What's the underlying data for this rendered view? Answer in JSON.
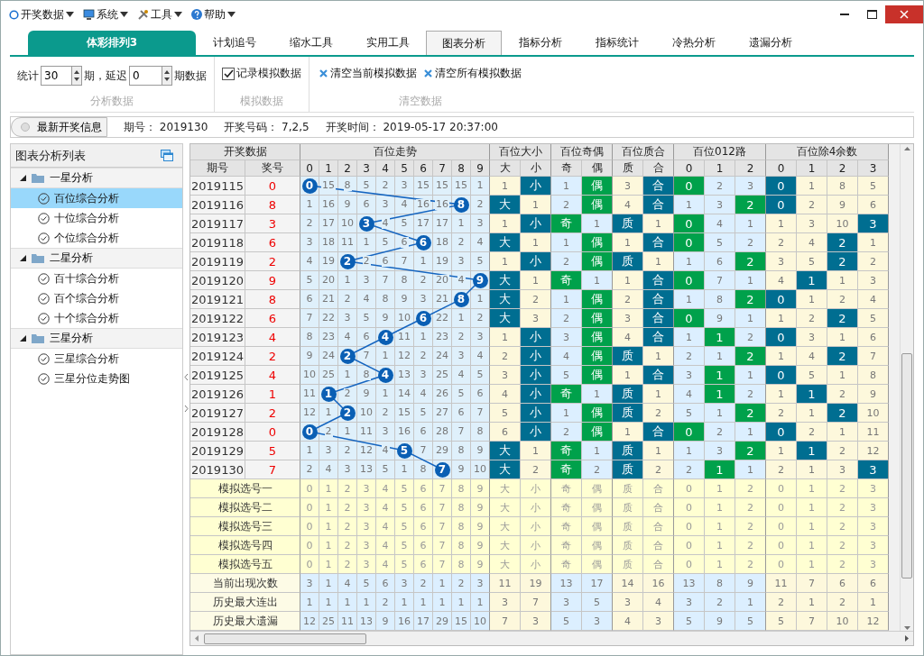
{
  "menu": [
    {
      "label": "开奖数据"
    },
    {
      "label": "系统"
    },
    {
      "label": "工具"
    },
    {
      "label": "帮助"
    }
  ],
  "tabs": [
    {
      "label": "体彩排列3",
      "kind": "product",
      "selected": false
    },
    {
      "label": "计划追号",
      "kind": "tab",
      "selected": false
    },
    {
      "label": "缩水工具",
      "kind": "tab",
      "selected": false
    },
    {
      "label": "实用工具",
      "kind": "tab",
      "selected": false
    },
    {
      "label": "图表分析",
      "kind": "tab",
      "selected": true
    },
    {
      "label": "指标分析",
      "kind": "tab",
      "selected": false
    },
    {
      "label": "指标统计",
      "kind": "tab",
      "selected": false
    },
    {
      "label": "冷热分析",
      "kind": "tab",
      "selected": false
    },
    {
      "label": "遗漏分析",
      "kind": "tab",
      "selected": false
    }
  ],
  "analysis": {
    "caption": "分析数据",
    "prefix": "统计",
    "periods": "30",
    "middle": "期，延迟",
    "delay": "0",
    "suffix": "期数据"
  },
  "simulation": {
    "caption": "模拟数据",
    "checkbox": {
      "label": "记录模拟数据",
      "checked": true
    }
  },
  "clear": {
    "caption": "清空数据",
    "buttons": [
      "清空当前模拟数据",
      "清空所有模拟数据"
    ]
  },
  "info": {
    "toggle": "最新开奖信息",
    "fields": [
      {
        "label": "期号：",
        "value": "2019130"
      },
      {
        "label": "开奖号码：",
        "value": "7,2,5"
      },
      {
        "label": "开奖时间：",
        "value": "2019-05-17 20:37:00"
      }
    ]
  },
  "sidebar": {
    "title": "图表分析列表",
    "groups": [
      {
        "label": "一星分析",
        "expanded": true,
        "children": [
          {
            "label": "百位综合分析",
            "selected": true
          },
          {
            "label": "十位综合分析",
            "selected": false
          },
          {
            "label": "个位综合分析",
            "selected": false
          }
        ]
      },
      {
        "label": "二星分析",
        "expanded": true,
        "children": [
          {
            "label": "百十综合分析",
            "selected": false
          },
          {
            "label": "百个综合分析",
            "selected": false
          },
          {
            "label": "十个综合分析",
            "selected": false
          }
        ]
      },
      {
        "label": "三星分析",
        "expanded": true,
        "children": [
          {
            "label": "三星综合分析",
            "selected": false
          },
          {
            "label": "三星分位走势图",
            "selected": false
          }
        ]
      }
    ]
  },
  "table": {
    "draw_title": "开奖数据",
    "period_header": "期号",
    "number_header": "奖号",
    "trend_title": "百位走势",
    "digits": [
      "0",
      "1",
      "2",
      "3",
      "4",
      "5",
      "6",
      "7",
      "8",
      "9"
    ],
    "groups": [
      {
        "title": "百位大小",
        "color": "#006e91",
        "columns": [
          "大",
          "小"
        ]
      },
      {
        "title": "百位奇偶",
        "color": "#00a14b",
        "columns": [
          "奇",
          "偶"
        ]
      },
      {
        "title": "百位质合",
        "color": "#006e91",
        "columns": [
          "质",
          "合"
        ]
      },
      {
        "title": "百位012路",
        "color": "#00a14b",
        "columns": [
          "0",
          "1",
          "2"
        ]
      },
      {
        "title": "百位除4余数",
        "color": "#006e91",
        "columns": [
          "0",
          "1",
          "2",
          "3"
        ]
      }
    ],
    "rows": [
      {
        "period": "2019115",
        "number": "0",
        "cells": [
          "0",
          "15",
          "8",
          "5",
          "2",
          "3",
          "15",
          "15",
          "15",
          "1",
          "1",
          "小",
          "1",
          "偶",
          "3",
          "合",
          "0",
          "2",
          "3",
          "0",
          "1",
          "8",
          "5"
        ],
        "hits": [
          true,
          false,
          false,
          false,
          false,
          false,
          false,
          false,
          false,
          false,
          false,
          true,
          false,
          true,
          false,
          true,
          true,
          false,
          false,
          true,
          false,
          false,
          false
        ]
      },
      {
        "period": "2019116",
        "number": "8",
        "cells": [
          "1",
          "16",
          "9",
          "6",
          "3",
          "4",
          "16",
          "16",
          "8",
          "2",
          "大",
          "1",
          "2",
          "偶",
          "4",
          "合",
          "1",
          "3",
          "2",
          "0",
          "2",
          "9",
          "6"
        ],
        "hits": [
          false,
          false,
          false,
          false,
          false,
          false,
          false,
          false,
          true,
          false,
          true,
          false,
          false,
          true,
          false,
          true,
          false,
          false,
          true,
          true,
          false,
          false,
          false
        ]
      },
      {
        "period": "2019117",
        "number": "3",
        "cells": [
          "2",
          "17",
          "10",
          "3",
          "4",
          "5",
          "17",
          "17",
          "1",
          "3",
          "1",
          "小",
          "奇",
          "1",
          "质",
          "1",
          "0",
          "4",
          "1",
          "1",
          "3",
          "10",
          "3"
        ],
        "hits": [
          false,
          false,
          false,
          true,
          false,
          false,
          false,
          false,
          false,
          false,
          false,
          true,
          true,
          false,
          true,
          false,
          true,
          false,
          false,
          false,
          false,
          false,
          true
        ]
      },
      {
        "period": "2019118",
        "number": "6",
        "cells": [
          "3",
          "18",
          "11",
          "1",
          "5",
          "6",
          "6",
          "18",
          "2",
          "4",
          "大",
          "1",
          "1",
          "偶",
          "1",
          "合",
          "0",
          "5",
          "2",
          "2",
          "4",
          "2",
          "1"
        ],
        "hits": [
          false,
          false,
          false,
          false,
          false,
          false,
          true,
          false,
          false,
          false,
          true,
          false,
          false,
          true,
          false,
          true,
          true,
          false,
          false,
          false,
          false,
          true,
          false
        ]
      },
      {
        "period": "2019119",
        "number": "2",
        "cells": [
          "4",
          "19",
          "2",
          "2",
          "6",
          "7",
          "1",
          "19",
          "3",
          "5",
          "1",
          "小",
          "2",
          "偶",
          "质",
          "1",
          "1",
          "6",
          "2",
          "3",
          "5",
          "2",
          "2"
        ],
        "hits": [
          false,
          false,
          true,
          false,
          false,
          false,
          false,
          false,
          false,
          false,
          false,
          true,
          false,
          true,
          true,
          false,
          false,
          false,
          true,
          false,
          false,
          true,
          false
        ]
      },
      {
        "period": "2019120",
        "number": "9",
        "cells": [
          "5",
          "20",
          "1",
          "3",
          "7",
          "8",
          "2",
          "20",
          "4",
          "9",
          "大",
          "1",
          "奇",
          "1",
          "1",
          "合",
          "0",
          "7",
          "1",
          "4",
          "1",
          "1",
          "3"
        ],
        "hits": [
          false,
          false,
          false,
          false,
          false,
          false,
          false,
          false,
          false,
          true,
          true,
          false,
          true,
          false,
          false,
          true,
          true,
          false,
          false,
          false,
          true,
          false,
          false
        ]
      },
      {
        "period": "2019121",
        "number": "8",
        "cells": [
          "6",
          "21",
          "2",
          "4",
          "8",
          "9",
          "3",
          "21",
          "8",
          "1",
          "大",
          "2",
          "1",
          "偶",
          "2",
          "合",
          "1",
          "8",
          "2",
          "0",
          "1",
          "2",
          "4"
        ],
        "hits": [
          false,
          false,
          false,
          false,
          false,
          false,
          false,
          false,
          true,
          false,
          true,
          false,
          false,
          true,
          false,
          true,
          false,
          false,
          true,
          true,
          false,
          false,
          false
        ]
      },
      {
        "period": "2019122",
        "number": "6",
        "cells": [
          "7",
          "22",
          "3",
          "5",
          "9",
          "10",
          "6",
          "22",
          "1",
          "2",
          "大",
          "3",
          "2",
          "偶",
          "3",
          "合",
          "0",
          "9",
          "1",
          "1",
          "2",
          "2",
          "5"
        ],
        "hits": [
          false,
          false,
          false,
          false,
          false,
          false,
          true,
          false,
          false,
          false,
          true,
          false,
          false,
          true,
          false,
          true,
          true,
          false,
          false,
          false,
          false,
          true,
          false
        ]
      },
      {
        "period": "2019123",
        "number": "4",
        "cells": [
          "8",
          "23",
          "4",
          "6",
          "4",
          "11",
          "1",
          "23",
          "2",
          "3",
          "1",
          "小",
          "3",
          "偶",
          "4",
          "合",
          "1",
          "1",
          "2",
          "0",
          "3",
          "1",
          "6"
        ],
        "hits": [
          false,
          false,
          false,
          false,
          true,
          false,
          false,
          false,
          false,
          false,
          false,
          true,
          false,
          true,
          false,
          true,
          false,
          true,
          false,
          true,
          false,
          false,
          false
        ]
      },
      {
        "period": "2019124",
        "number": "2",
        "cells": [
          "9",
          "24",
          "2",
          "7",
          "1",
          "12",
          "2",
          "24",
          "3",
          "4",
          "2",
          "小",
          "4",
          "偶",
          "质",
          "1",
          "2",
          "1",
          "2",
          "1",
          "4",
          "2",
          "7"
        ],
        "hits": [
          false,
          false,
          true,
          false,
          false,
          false,
          false,
          false,
          false,
          false,
          false,
          true,
          false,
          true,
          true,
          false,
          false,
          false,
          true,
          false,
          false,
          true,
          false
        ]
      },
      {
        "period": "2019125",
        "number": "4",
        "cells": [
          "10",
          "25",
          "1",
          "8",
          "4",
          "13",
          "3",
          "25",
          "4",
          "5",
          "3",
          "小",
          "5",
          "偶",
          "1",
          "合",
          "3",
          "1",
          "1",
          "0",
          "5",
          "1",
          "8"
        ],
        "hits": [
          false,
          false,
          false,
          false,
          true,
          false,
          false,
          false,
          false,
          false,
          false,
          true,
          false,
          true,
          false,
          true,
          false,
          true,
          false,
          true,
          false,
          false,
          false
        ]
      },
      {
        "period": "2019126",
        "number": "1",
        "cells": [
          "11",
          "1",
          "2",
          "9",
          "1",
          "14",
          "4",
          "26",
          "5",
          "6",
          "4",
          "小",
          "奇",
          "1",
          "质",
          "1",
          "4",
          "1",
          "2",
          "1",
          "1",
          "2",
          "9"
        ],
        "hits": [
          false,
          true,
          false,
          false,
          false,
          false,
          false,
          false,
          false,
          false,
          false,
          true,
          true,
          false,
          true,
          false,
          false,
          true,
          false,
          false,
          true,
          false,
          false
        ]
      },
      {
        "period": "2019127",
        "number": "2",
        "cells": [
          "12",
          "1",
          "2",
          "10",
          "2",
          "15",
          "5",
          "27",
          "6",
          "7",
          "5",
          "小",
          "1",
          "偶",
          "质",
          "2",
          "5",
          "1",
          "2",
          "2",
          "1",
          "2",
          "10"
        ],
        "hits": [
          false,
          false,
          true,
          false,
          false,
          false,
          false,
          false,
          false,
          false,
          false,
          true,
          false,
          true,
          true,
          false,
          false,
          false,
          true,
          false,
          false,
          true,
          false
        ]
      },
      {
        "period": "2019128",
        "number": "0",
        "cells": [
          "0",
          "2",
          "1",
          "11",
          "3",
          "16",
          "6",
          "28",
          "7",
          "8",
          "6",
          "小",
          "2",
          "偶",
          "1",
          "合",
          "0",
          "2",
          "1",
          "0",
          "2",
          "1",
          "11"
        ],
        "hits": [
          true,
          false,
          false,
          false,
          false,
          false,
          false,
          false,
          false,
          false,
          false,
          true,
          false,
          true,
          false,
          true,
          true,
          false,
          false,
          true,
          false,
          false,
          false
        ]
      },
      {
        "period": "2019129",
        "number": "5",
        "cells": [
          "1",
          "3",
          "2",
          "12",
          "4",
          "5",
          "7",
          "29",
          "8",
          "9",
          "大",
          "1",
          "奇",
          "1",
          "质",
          "1",
          "1",
          "3",
          "2",
          "1",
          "1",
          "2",
          "12"
        ],
        "hits": [
          false,
          false,
          false,
          false,
          false,
          true,
          false,
          false,
          false,
          false,
          true,
          false,
          true,
          false,
          true,
          false,
          false,
          false,
          true,
          false,
          true,
          false,
          false
        ]
      },
      {
        "period": "2019130",
        "number": "7",
        "cells": [
          "2",
          "4",
          "3",
          "13",
          "5",
          "1",
          "8",
          "7",
          "9",
          "10",
          "大",
          "2",
          "奇",
          "2",
          "质",
          "2",
          "2",
          "1",
          "1",
          "2",
          "1",
          "3",
          "3"
        ],
        "hits": [
          false,
          false,
          false,
          false,
          false,
          false,
          false,
          true,
          false,
          false,
          true,
          false,
          true,
          false,
          true,
          false,
          false,
          true,
          false,
          false,
          false,
          false,
          true
        ]
      }
    ],
    "summary": [
      {
        "label": "模拟选号一",
        "kind": "simulation",
        "cells": [
          "0",
          "1",
          "2",
          "3",
          "4",
          "5",
          "6",
          "7",
          "8",
          "9",
          "大",
          "小",
          "奇",
          "偶",
          "质",
          "合",
          "0",
          "1",
          "2",
          "0",
          "1",
          "2",
          "3"
        ]
      },
      {
        "label": "模拟选号二",
        "kind": "simulation",
        "cells": [
          "0",
          "1",
          "2",
          "3",
          "4",
          "5",
          "6",
          "7",
          "8",
          "9",
          "大",
          "小",
          "奇",
          "偶",
          "质",
          "合",
          "0",
          "1",
          "2",
          "0",
          "1",
          "2",
          "3"
        ]
      },
      {
        "label": "模拟选号三",
        "kind": "simulation",
        "cells": [
          "0",
          "1",
          "2",
          "3",
          "4",
          "5",
          "6",
          "7",
          "8",
          "9",
          "大",
          "小",
          "奇",
          "偶",
          "质",
          "合",
          "0",
          "1",
          "2",
          "0",
          "1",
          "2",
          "3"
        ]
      },
      {
        "label": "模拟选号四",
        "kind": "simulation",
        "cells": [
          "0",
          "1",
          "2",
          "3",
          "4",
          "5",
          "6",
          "7",
          "8",
          "9",
          "大",
          "小",
          "奇",
          "偶",
          "质",
          "合",
          "0",
          "1",
          "2",
          "0",
          "1",
          "2",
          "3"
        ]
      },
      {
        "label": "模拟选号五",
        "kind": "simulation",
        "cells": [
          "0",
          "1",
          "2",
          "3",
          "4",
          "5",
          "6",
          "7",
          "8",
          "9",
          "大",
          "小",
          "奇",
          "偶",
          "质",
          "合",
          "0",
          "1",
          "2",
          "0",
          "1",
          "2",
          "3"
        ]
      },
      {
        "label": "当前出现次数",
        "kind": "stat",
        "cells": [
          "3",
          "1",
          "4",
          "5",
          "6",
          "3",
          "2",
          "1",
          "2",
          "3",
          "11",
          "19",
          "13",
          "17",
          "14",
          "16",
          "13",
          "8",
          "9",
          "11",
          "7",
          "6",
          "6"
        ]
      },
      {
        "label": "历史最大连出",
        "kind": "stat",
        "cells": [
          "1",
          "1",
          "1",
          "1",
          "2",
          "1",
          "1",
          "1",
          "1",
          "1",
          "3",
          "7",
          "3",
          "5",
          "3",
          "4",
          "3",
          "2",
          "1",
          "2",
          "1",
          "2",
          "1"
        ]
      },
      {
        "label": "历史最大遗漏",
        "kind": "stat",
        "cells": [
          "12",
          "25",
          "11",
          "13",
          "9",
          "16",
          "17",
          "29",
          "15",
          "10",
          "7",
          "3",
          "5",
          "3",
          "4",
          "3",
          "5",
          "9",
          "5",
          "5",
          "7",
          "10",
          "12"
        ]
      }
    ]
  }
}
